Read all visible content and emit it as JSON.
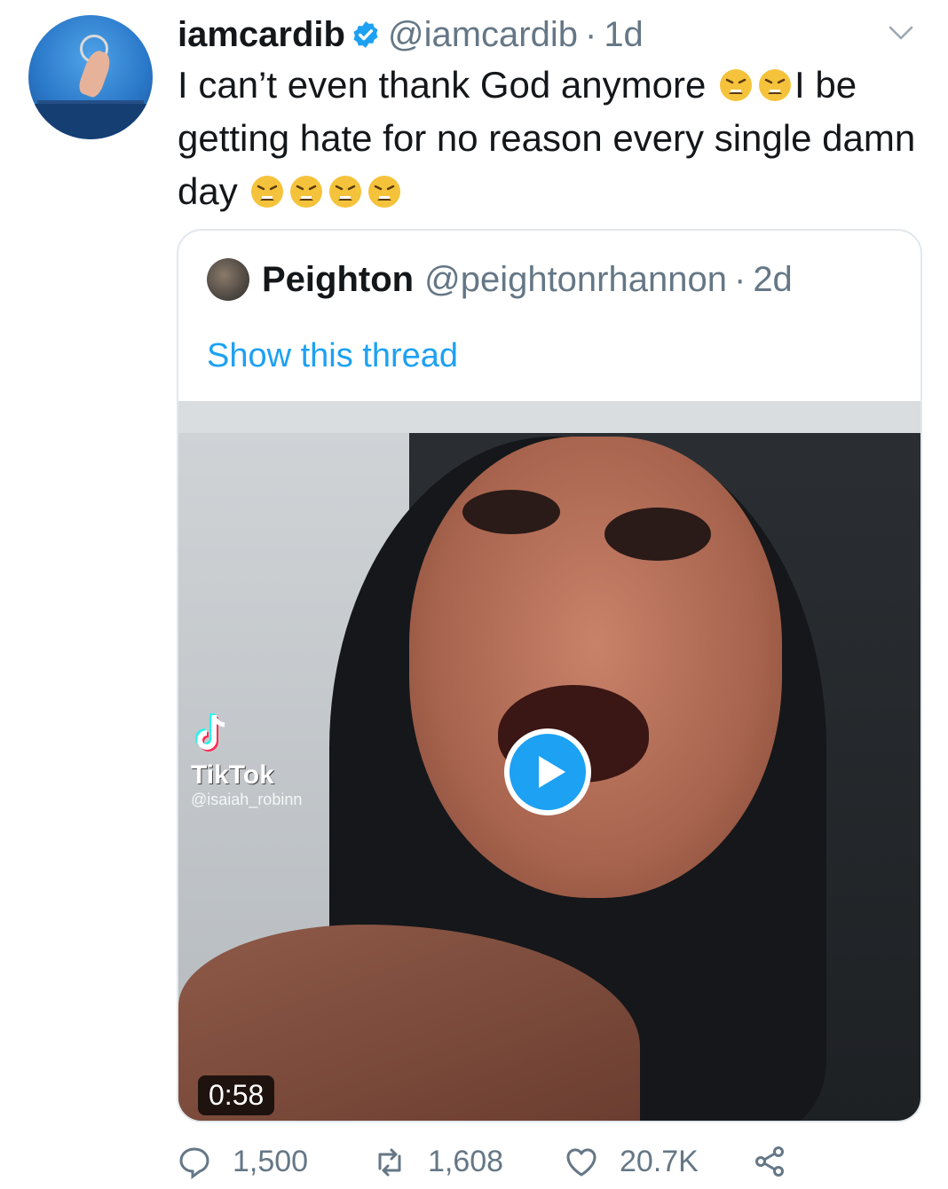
{
  "tweet": {
    "display_name": "iamcardib",
    "handle": "@iamcardib",
    "separator": "·",
    "time": "1d",
    "text_part1": "I can’t even thank God anymore",
    "text_part2": "I be getting hate for no reason every single damn day",
    "emoji_name": "weary-face"
  },
  "quoted": {
    "display_name": "Peighton",
    "handle": "@peightonrhannon",
    "separator": "·",
    "time": "2d",
    "show_thread": "Show this thread",
    "video": {
      "watermark_brand": "TikTok",
      "watermark_user": "@isaiah_robinn",
      "duration": "0:58"
    }
  },
  "actions": {
    "replies": "1,500",
    "retweets": "1,608",
    "likes": "20.7K"
  },
  "colors": {
    "accent": "#1da1f2",
    "secondary_text": "#657786",
    "emoji": "#f5c33b"
  }
}
